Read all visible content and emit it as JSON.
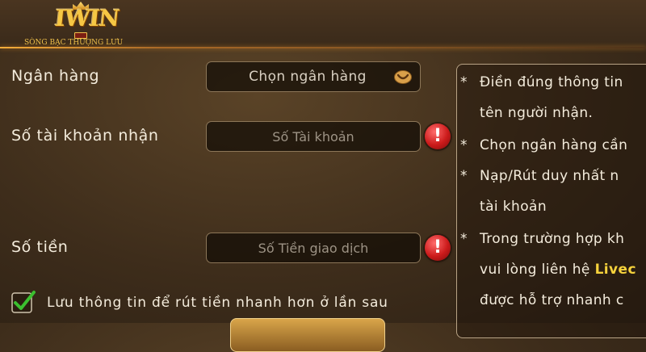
{
  "header": {
    "logo_text": "IWIN",
    "logo_tagline": "SÒNG BẠC THƯỢNG LƯU"
  },
  "form": {
    "bank": {
      "label": "Ngân hàng",
      "value": "Chọn ngân hàng",
      "icon": "chevron-down-icon"
    },
    "account": {
      "label": "Số tài khoản nhận",
      "placeholder": "Số Tài khoản",
      "icon": "warning-icon"
    },
    "amount": {
      "label": "Số tiền",
      "placeholder": "Số Tiền giao dịch",
      "icon": "warning-icon"
    },
    "save_info": {
      "label": "Lưu thông tin để rút tiền nhanh hơn ở lần sau",
      "checked": true
    }
  },
  "info": {
    "bullet": "*",
    "lines": [
      "Điền đúng thông tin",
      "tên người nhận.",
      "Chọn ngân hàng cần",
      "Nạp/Rút duy nhất n",
      "tài khoản",
      "Trong trường hợp kh",
      "vui lòng liên hệ ",
      "được hỗ trợ nhanh c"
    ],
    "livechat_text": "Livec"
  },
  "colors": {
    "background": "#3e2d1b",
    "accent_gold": "#f6c744",
    "warning_red": "#cc1b1b",
    "checkbox_green": "#3bbf2f",
    "highlight_yellow": "#f6d23c"
  }
}
